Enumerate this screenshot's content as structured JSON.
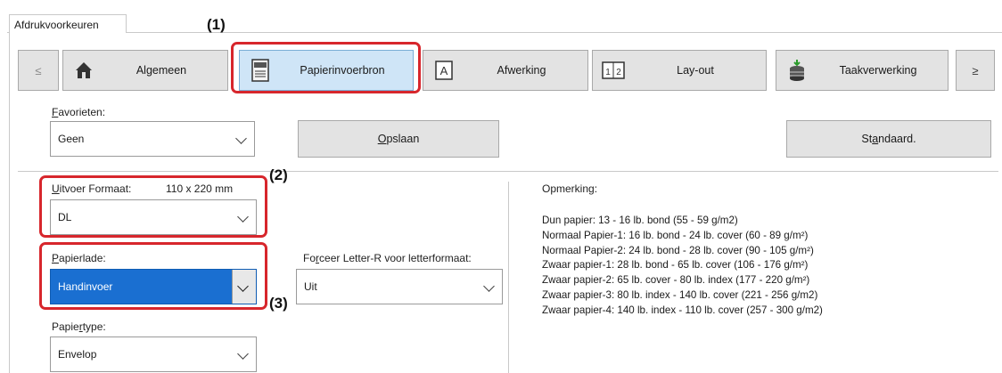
{
  "window": {
    "tab_label": "Afdrukvoorkeuren"
  },
  "callouts": {
    "c1": "(1)",
    "c2": "(2)",
    "c3": "(3)"
  },
  "toolbar": {
    "nav_prev": "≤",
    "nav_next": "≥",
    "tabs": [
      {
        "label": "Algemeen",
        "icon": "home-icon"
      },
      {
        "label": "Papierinvoerbron",
        "icon": "paper-tray-icon",
        "selected": true
      },
      {
        "label": "Afwerking",
        "icon": "finishing-icon"
      },
      {
        "label": "Lay-out",
        "icon": "layout-icon"
      },
      {
        "label": "Taakverwerking",
        "icon": "job-handling-icon"
      }
    ]
  },
  "favorites": {
    "label_prefix": "F",
    "label_rest": "avorieten:",
    "value": "Geen",
    "save_prefix": "O",
    "save_rest": "pslaan",
    "default_pre": "St",
    "default_ul": "a",
    "default_post": "ndaard."
  },
  "output_format": {
    "label_prefix": "U",
    "label_rest": "itvoer Formaat:",
    "size": "110 x 220 mm",
    "value": "DL"
  },
  "paper_tray": {
    "label_prefix": "P",
    "label_rest": "apierlade:",
    "value": "Handinvoer"
  },
  "paper_type": {
    "label_pre": "Papie",
    "label_ul": "r",
    "label_post": "type:",
    "value": "Envelop"
  },
  "force_letter": {
    "label_pre": "Fo",
    "label_ul": "r",
    "label_post": "ceer Letter-R voor letterformaat:",
    "value": "Uit"
  },
  "remarks": {
    "title": "Opmerking:",
    "lines": [
      "Dun papier: 13 - 16 lb. bond (55 - 59 g/m2)",
      "Normaal Papier-1: 16 lb. bond - 24 lb. cover (60 - 89 g/m²)",
      "Normaal Papier-2: 24 lb. bond - 28 lb. cover (90 - 105 g/m²)",
      "Zwaar papier-1: 28 lb. bond - 65 lb. cover (106 - 176 g/m²)",
      "Zwaar papier-2: 65 lb. cover - 80 lb. index (177 - 220 g/m²)",
      "Zwaar papier-3: 80 lb. index - 140 lb. cover (221 - 256 g/m2)",
      "Zwaar papier-4: 140 lb. index - 110 lb. cover (257 - 300 g/m2)"
    ]
  },
  "colors": {
    "highlight": "#d7262c",
    "selected_tab": "#cfe5f7",
    "selected_field": "#1a6fd1"
  }
}
